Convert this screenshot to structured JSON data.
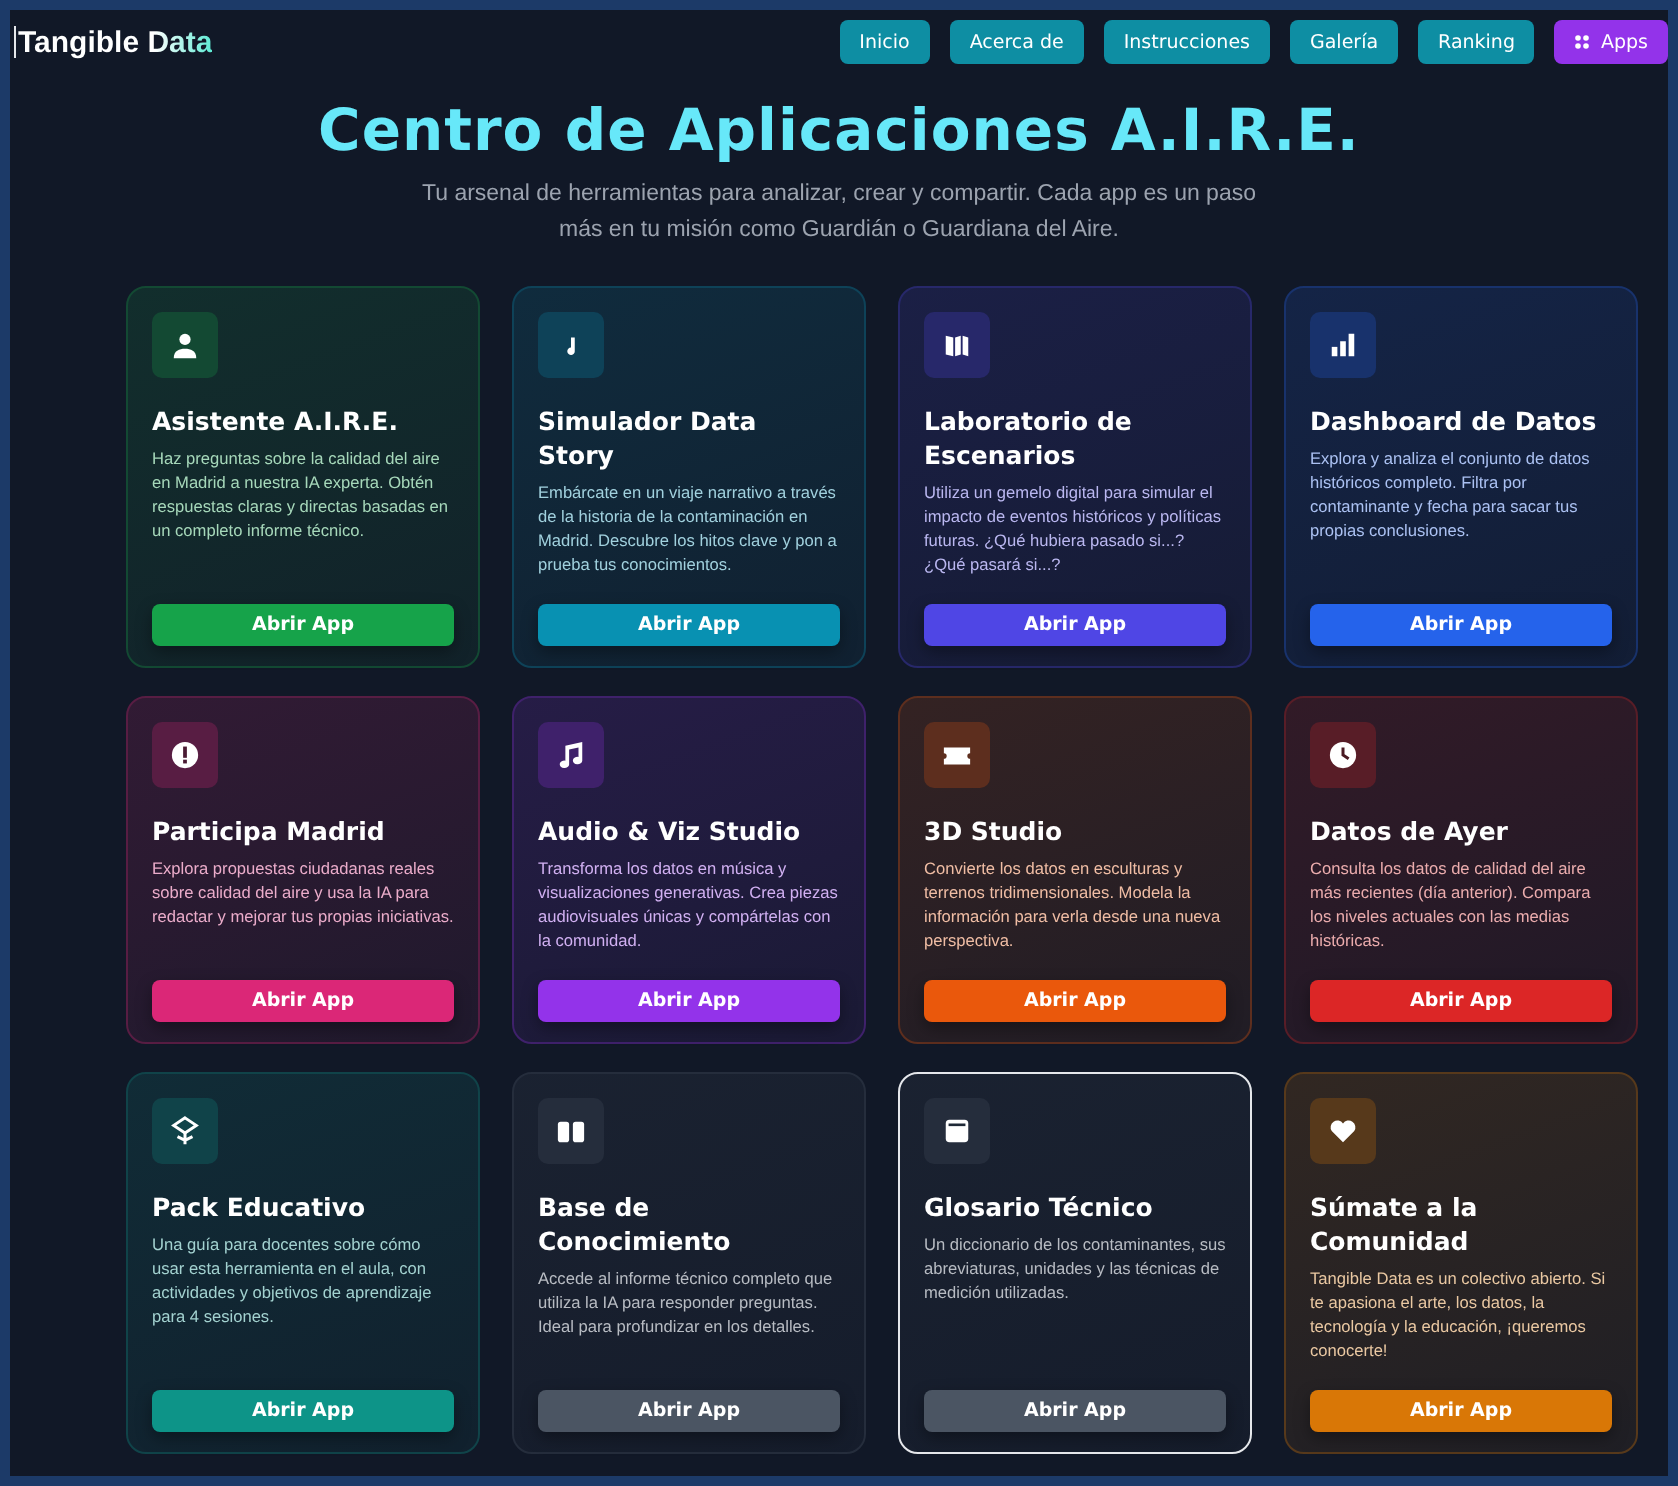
{
  "brand": "Tangible Data",
  "nav": [
    {
      "label": "Inicio",
      "selected": false
    },
    {
      "label": "Acerca de",
      "selected": false
    },
    {
      "label": "Instrucciones",
      "selected": false
    },
    {
      "label": "Galería",
      "selected": false
    },
    {
      "label": "Ranking",
      "selected": false
    },
    {
      "label": "Apps",
      "selected": true
    }
  ],
  "title": "Centro de Aplicaciones A.I.R.E.",
  "subtitle": "Tu arsenal de herramientas para analizar, crear y compartir. Cada app es un paso más en tu misión como Guardián o Guardiana del Aire.",
  "apps": [
    {
      "name": "Asistente A.I.R.E.",
      "description": "Haz preguntas sobre la calidad del aire en Madrid a nuestra IA experta. Obtén respuestas claras y directas basadas en un completo informe técnico.",
      "button": "Abrir App",
      "color": "#16a34a",
      "selected": false
    },
    {
      "name": "Simulador Data Story",
      "description": "Embárcate en un viaje narrativo a través de la historia de la contaminación en Madrid. Descubre los hitos clave y pon a prueba tus conocimientos.",
      "button": "Abrir App",
      "color": "#0891b2",
      "selected": false
    },
    {
      "name": "Laboratorio de Escenarios",
      "description": "Utiliza un gemelo digital para simular el impacto de eventos históricos y políticas futuras. ¿Qué hubiera pasado si...? ¿Qué pasará si...?",
      "button": "Abrir App",
      "color": "#4f46e5",
      "selected": false
    },
    {
      "name": "Dashboard de Datos",
      "description": "Explora y analiza el conjunto de datos históricos completo. Filtra por contaminante y fecha para sacar tus propias conclusiones.",
      "button": "Abrir App",
      "color": "#2563eb",
      "selected": false
    },
    {
      "name": "Participa Madrid",
      "description": "Explora propuestas ciudadanas reales sobre calidad del aire y usa la IA para redactar y mejorar tus propias iniciativas.",
      "button": "Abrir App",
      "color": "#db2777",
      "selected": false
    },
    {
      "name": "Audio & Viz Studio",
      "description": "Transforma los datos en música y visualizaciones generativas. Crea piezas audiovisuales únicas y compártelas con la comunidad.",
      "button": "Abrir App",
      "color": "#9333ea",
      "selected": false
    },
    {
      "name": "3D Studio",
      "description": "Convierte los datos en esculturas y terrenos tridimensionales. Modela la información para verla desde una nueva perspectiva.",
      "button": "Abrir App",
      "color": "#ea580c",
      "selected": false
    },
    {
      "name": "Datos de Ayer",
      "description": "Consulta los datos de calidad del aire más recientes (día anterior). Compara los niveles actuales con las medias históricas.",
      "button": "Abrir App",
      "color": "#dc2626",
      "selected": false
    },
    {
      "name": "Pack Educativo",
      "description": "Una guía para docentes sobre cómo usar esta herramienta en el aula, con actividades y objetivos de aprendizaje para 4 sesiones.",
      "button": "Abrir App",
      "color": "#0d9488",
      "selected": false
    },
    {
      "name": "Base de Conocimiento",
      "description": "Accede al informe técnico completo que utiliza la IA para responder preguntas. Ideal para profundizar en los detalles.",
      "button": "Abrir App",
      "color": "#4b5563",
      "selected": false
    },
    {
      "name": "Glosario Técnico",
      "description": "Un diccionario de los contaminantes, sus abreviaturas, unidades y las técnicas de medición utilizadas.",
      "button": "Abrir App",
      "color": "#4b5563",
      "selected": true
    },
    {
      "name": "Súmate a la Comunidad",
      "description": "Tangible Data es un colectivo abierto. Si te apasiona el arte, los datos, la tecnología y la educación, ¡queremos conocerte!",
      "button": "Abrir App",
      "color": "#d97706",
      "selected": false
    }
  ]
}
